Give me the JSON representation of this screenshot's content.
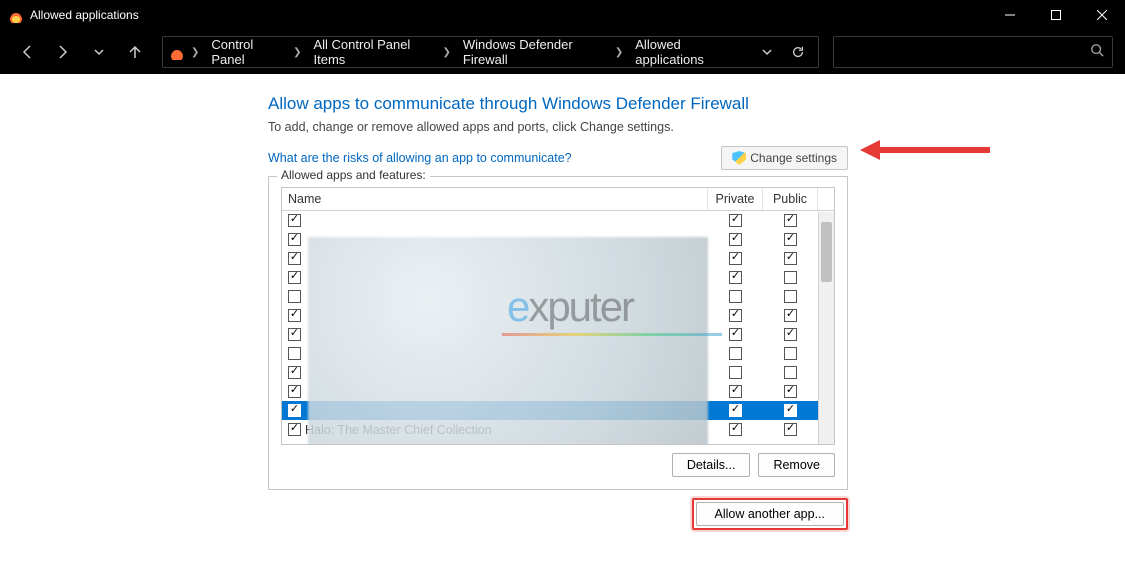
{
  "titlebar": {
    "title": "Allowed applications"
  },
  "breadcrumb": {
    "items": [
      "Control Panel",
      "All Control Panel Items",
      "Windows Defender Firewall",
      "Allowed applications"
    ]
  },
  "page": {
    "heading": "Allow apps to communicate through Windows Defender Firewall",
    "subheading": "To add, change or remove allowed apps and ports, click Change settings.",
    "risk_link": "What are the risks of allowing an app to communicate?",
    "change_settings": "Change settings",
    "group_label": "Allowed apps and features:",
    "columns": {
      "name": "Name",
      "private": "Private",
      "public": "Public"
    },
    "details": "Details...",
    "remove": "Remove",
    "allow_another": "Allow another app..."
  },
  "rows": [
    {
      "name": "",
      "enabled": true,
      "private": true,
      "public": true
    },
    {
      "name": "",
      "enabled": true,
      "private": true,
      "public": true
    },
    {
      "name": "",
      "enabled": true,
      "private": true,
      "public": true
    },
    {
      "name": "",
      "enabled": true,
      "private": true,
      "public": false
    },
    {
      "name": "",
      "enabled": false,
      "private": false,
      "public": false
    },
    {
      "name": "",
      "enabled": true,
      "private": true,
      "public": true
    },
    {
      "name": "",
      "enabled": true,
      "private": true,
      "public": true
    },
    {
      "name": "",
      "enabled": false,
      "private": false,
      "public": false
    },
    {
      "name": "",
      "enabled": true,
      "private": false,
      "public": false
    },
    {
      "name": "",
      "enabled": true,
      "private": true,
      "public": true
    },
    {
      "name": "",
      "enabled": true,
      "private": true,
      "public": true,
      "selected": true
    },
    {
      "name": "Halo: The Master Chief Collection",
      "enabled": true,
      "private": true,
      "public": true
    }
  ],
  "watermark": "exputer"
}
